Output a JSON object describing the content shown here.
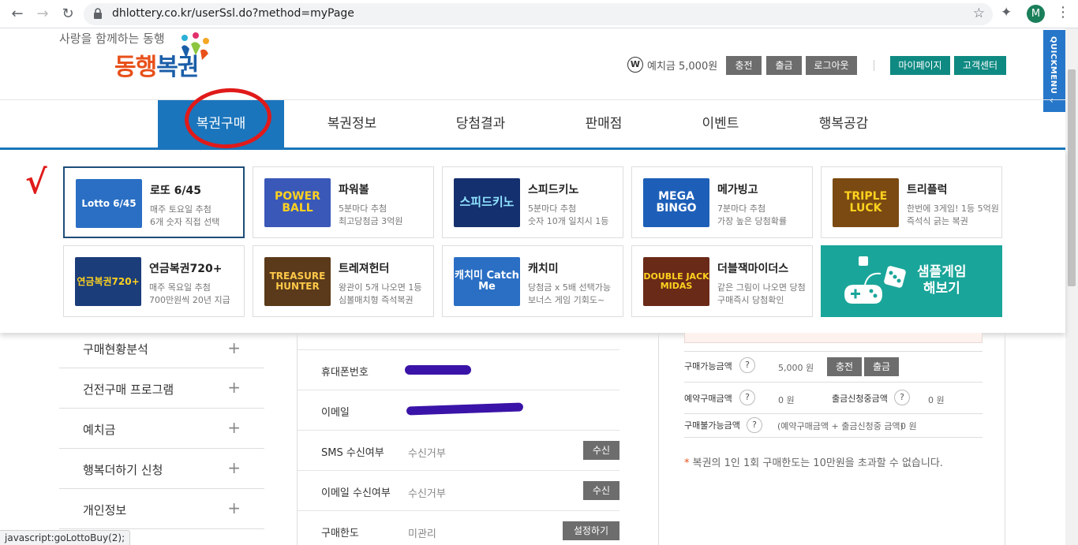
{
  "browser": {
    "url": "dhlottery.co.kr/userSsl.do?method=myPage",
    "avatar_letter": "M",
    "back": "←",
    "forward": "→",
    "reload": "↻",
    "star": "☆",
    "ext": "✦",
    "menu": "⋮"
  },
  "header": {
    "slogan": "사랑을 함께하는 동행",
    "logo_part1": "동행",
    "logo_part2": "복권",
    "deposit_icon": "W",
    "deposit_text": "예치금 5,000원",
    "buttons": {
      "charge": "충전",
      "withdraw": "출금",
      "logout": "로그아웃",
      "mypage": "마이페이지",
      "support": "고객센터"
    },
    "quickmenu": "QUICKMENU",
    "quickmenu_arrow": "‹"
  },
  "gnb": {
    "items": [
      "복권구매",
      "복권정보",
      "당첨결과",
      "판매점",
      "이벤트",
      "행복공감"
    ],
    "active_index": 0
  },
  "annotations": {
    "check_mark": "√"
  },
  "games": [
    {
      "name": "로또 6/45",
      "desc1": "매주 토요일 추첨",
      "desc2": "6개 숫자 직접 선택",
      "thumb": "Lotto 6/45"
    },
    {
      "name": "파워볼",
      "desc1": "5분마다 추첨",
      "desc2": "최고당첨금 3억원",
      "thumb": "POWER BALL"
    },
    {
      "name": "스피드키노",
      "desc1": "5분마다 추첨",
      "desc2": "숫자 10개 일치시 1등",
      "thumb": "스피드키노"
    },
    {
      "name": "메가빙고",
      "desc1": "7분마다 추첨",
      "desc2": "가장 높은 당첨확률",
      "thumb": "MEGA BINGO"
    },
    {
      "name": "트리플럭",
      "desc1": "한번에 3게임! 1등 5억원",
      "desc2": "즉석식 긁는 복권",
      "thumb": "TRIPLE LUCK"
    },
    {
      "name": "연금복권720+",
      "desc1": "매주 목요일 추첨",
      "desc2": "700만원씩 20년 지급",
      "thumb": "연금복권720+"
    },
    {
      "name": "트레져헌터",
      "desc1": "왕관이 5개 나오면 1등",
      "desc2": "심볼매치형 즉석복권",
      "thumb": "TREASURE HUNTER"
    },
    {
      "name": "캐치미",
      "desc1": "당첨금 x 5배 선택가능",
      "desc2": "보너스 게임 기회도~",
      "thumb": "캐치미 Catch Me"
    },
    {
      "name": "더블잭마이더스",
      "desc1": "같은 그림이 나오면 당첨",
      "desc2": "구매즉시 당첨확인",
      "thumb": "DOUBLE JACK MIDAS"
    }
  ],
  "sample_game": {
    "line1": "샘플게임",
    "line2": "해보기"
  },
  "left_menu": [
    {
      "label": "구매현황분석",
      "icon": "+"
    },
    {
      "label": "건전구매 프로그램",
      "icon": "+"
    },
    {
      "label": "예치금",
      "icon": "+"
    },
    {
      "label": "행복더하기 신청",
      "icon": "+"
    },
    {
      "label": "개인정보",
      "icon": "+"
    }
  ],
  "member_info": {
    "phone_label": "휴대폰번호",
    "email_label": "이메일",
    "sms_label": "SMS 수신여부",
    "sms_value": "수신거부",
    "sms_btn": "수신",
    "email_recv_label": "이메일 수신여부",
    "email_recv_value": "수신거부",
    "email_recv_btn": "수신",
    "limit_label": "구매한도",
    "limit_value": "미관리",
    "limit_btn": "설정하기"
  },
  "deposit_info": {
    "available_label": "구매가능금액",
    "available_value": "5,000 원",
    "reserved_label": "예약구매금액",
    "reserved_value": "0 원",
    "withdraw_req_label": "출금신청중금액",
    "withdraw_req_value": "0 원",
    "unavailable_label": "구매불가능금액",
    "unavailable_note": "(예약구매금액 + 출금신청중 금액)",
    "unavailable_value": "0 원",
    "help": "?",
    "charge_btn": "충전",
    "withdraw_btn": "출금",
    "notice_mark": "*",
    "notice": "복권의 1인 1회 구매한도는 10만원을 초과할 수 없습니다."
  },
  "status_bar": "javascript:goLottoBuy(2);"
}
